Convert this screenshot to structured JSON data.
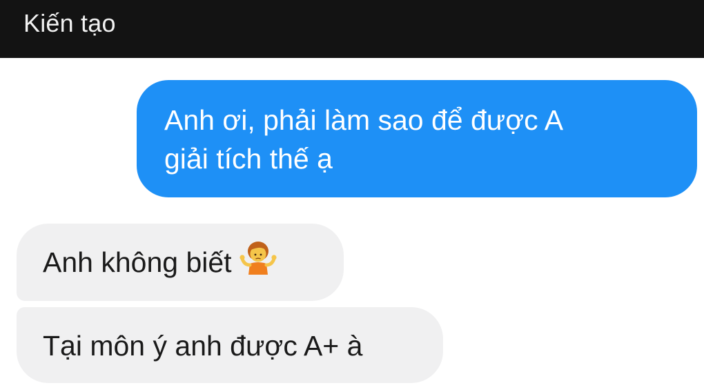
{
  "header": {
    "title": "Kiến tạo"
  },
  "messages": {
    "outgoing": {
      "line1": "Anh ơi, phải làm sao để được A",
      "line2": "giải tích thế ạ"
    },
    "incoming_1": {
      "text": "Anh không biết",
      "emoji": "person-shrugging-emoji"
    },
    "incoming_2": {
      "text": "Tại môn ý anh được A+ à"
    }
  },
  "colors": {
    "header_bg": "#131313",
    "outgoing_bubble": "#1e90f6",
    "incoming_bubble": "#f0f0f1"
  }
}
